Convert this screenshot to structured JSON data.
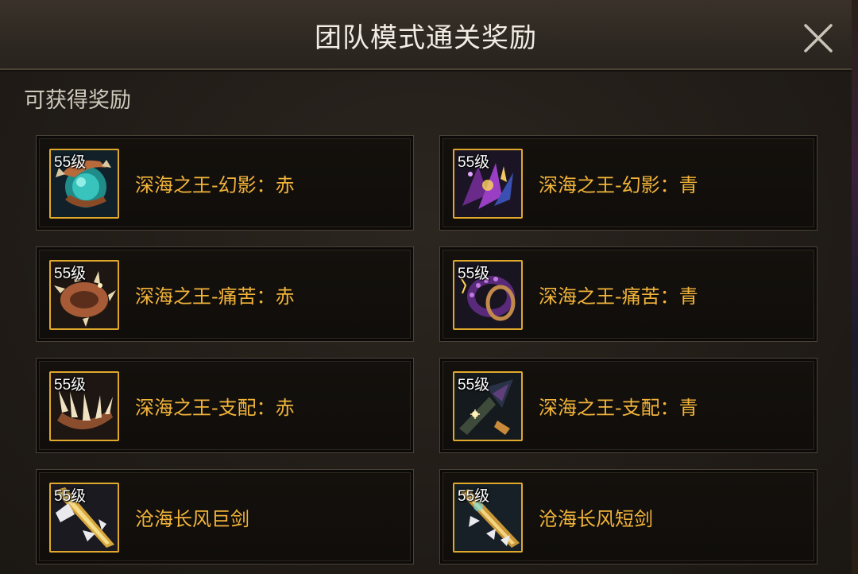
{
  "dialog": {
    "title": "团队模式通关奖励",
    "close_icon": "close-icon"
  },
  "section": {
    "label": "可获得奖励"
  },
  "rewards": [
    {
      "level": "55级",
      "name": "深海之王-幻影：赤",
      "icon": "teal-orb-ring-icon"
    },
    {
      "level": "55级",
      "name": "深海之王-幻影：青",
      "icon": "purple-spiked-claw-icon"
    },
    {
      "level": "55级",
      "name": "深海之王-痛苦：赤",
      "icon": "bronze-spiked-bracelet-icon"
    },
    {
      "level": "55级",
      "name": "深海之王-痛苦：青",
      "icon": "purple-scaled-ring-icon"
    },
    {
      "level": "55级",
      "name": "深海之王-支配：赤",
      "icon": "fanged-jaw-bracelet-icon"
    },
    {
      "level": "55级",
      "name": "深海之王-支配：青",
      "icon": "dark-trident-icon"
    },
    {
      "level": "55级",
      "name": "沧海长风巨剑",
      "icon": "golden-greatsword-icon"
    },
    {
      "level": "55级",
      "name": "沧海长风短剑",
      "icon": "golden-shortsword-icon"
    }
  ],
  "colors": {
    "accent_gold": "#e0a92c",
    "item_name": "#f2b43a",
    "title_text": "#f1ede4"
  }
}
